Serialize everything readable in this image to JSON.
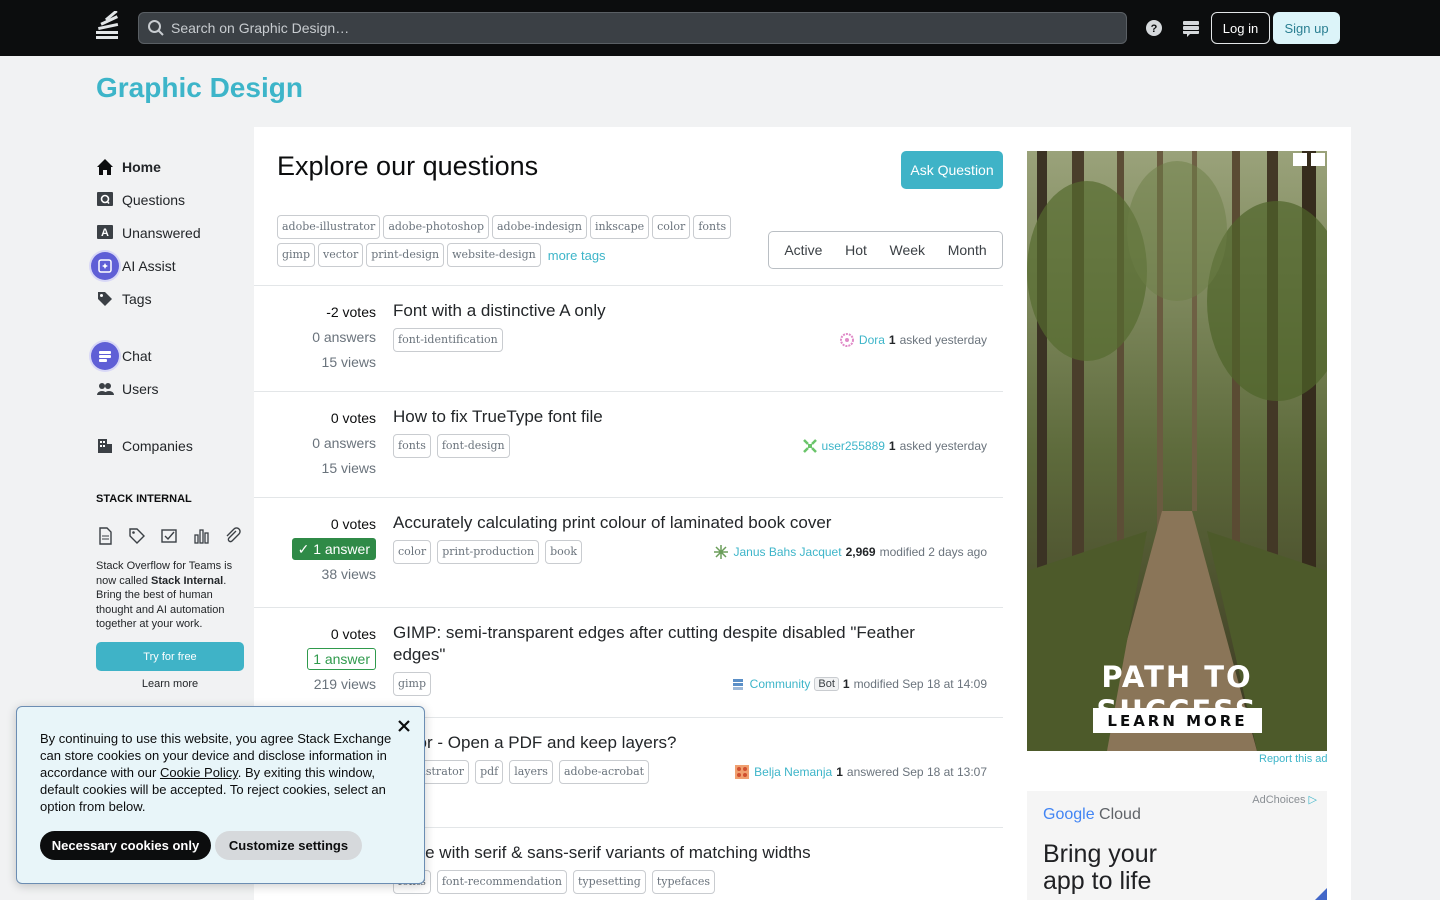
{
  "header": {
    "search_placeholder": "Search on Graphic Design…",
    "login_label": "Log in",
    "signup_label": "Sign up"
  },
  "site": {
    "title": "Graphic Design"
  },
  "nav": {
    "items": [
      {
        "label": "Home",
        "icon": "home-icon"
      },
      {
        "label": "Questions",
        "icon": "questions-icon"
      },
      {
        "label": "Unanswered",
        "icon": "unanswered-icon"
      },
      {
        "label": "AI Assist",
        "icon": "ai-assist-icon"
      },
      {
        "label": "Tags",
        "icon": "tag-icon"
      },
      {
        "label": "Chat",
        "icon": "chat-icon"
      },
      {
        "label": "Users",
        "icon": "users-icon"
      },
      {
        "label": "Companies",
        "icon": "companies-icon"
      }
    ],
    "stack_internal_heading": "STACK INTERNAL",
    "stack_internal_text_1": "Stack Overflow for Teams is now called ",
    "stack_internal_text_bold": "Stack Internal",
    "stack_internal_text_2": ". Bring the best of human thought and AI automation together at your work.",
    "try_label": "Try for free",
    "learn_more_label": "Learn more"
  },
  "main": {
    "heading": "Explore our questions",
    "ask_label": "Ask Question",
    "tags": [
      "adobe-illustrator",
      "adobe-photoshop",
      "adobe-indesign",
      "inkscape",
      "color",
      "fonts",
      "gimp",
      "vector",
      "print-design",
      "website-design"
    ],
    "more_tags_label": "more tags",
    "filters": [
      "Active",
      "Hot",
      "Week",
      "Month"
    ]
  },
  "questions": [
    {
      "votes": "-2 votes",
      "answers": "0 answers",
      "views": "15 views",
      "title": "Font with a distinctive A only",
      "tags": [
        "font-identification"
      ],
      "user": "Dora",
      "rep": "1",
      "action": "asked yesterday"
    },
    {
      "votes": "0 votes",
      "answers": "0 answers",
      "views": "15 views",
      "title": "How to fix TrueType font file",
      "tags": [
        "fonts",
        "font-design"
      ],
      "user": "user255889",
      "rep": "1",
      "action": "asked yesterday"
    },
    {
      "votes": "0 votes",
      "answers": "1 answer",
      "views": "38 views",
      "title": "Accurately calculating print colour of laminated book cover",
      "tags": [
        "color",
        "print-production",
        "book"
      ],
      "user": "Janus Bahs Jacquet",
      "rep": "2,969",
      "action": "modified 2 days ago"
    },
    {
      "votes": "0 votes",
      "answers": "1 answer",
      "views": "219 views",
      "title": "GIMP: semi-transparent edges after cutting despite disabled \"Feather edges\"",
      "tags": [
        "gimp"
      ],
      "user": "Community",
      "bot": "Bot",
      "rep": "1",
      "action": "modified Sep 18 at 14:09"
    },
    {
      "title": "trator - Open a PDF and keep layers?",
      "tags": [
        "e-illustrator",
        "pdf",
        "layers",
        "adobe-acrobat"
      ],
      "user": "Belja Nemanja",
      "rep": "1",
      "action": "answered Sep 18 at 13:07"
    },
    {
      "title": "eface with serif & sans-serif variants of matching widths",
      "tags": [
        "fonts",
        "font-recommendation",
        "typesetting",
        "typefaces"
      ]
    }
  ],
  "ads": {
    "tagline": "PATH TO SUCCESS",
    "cta": "LEARN MORE",
    "report_label": "Report this ad",
    "adchoices_label": "AdChoices",
    "gc_brand_g": "Google",
    "gc_brand_c": " Cloud",
    "headline_1": "Bring your",
    "headline_2": "app to life"
  },
  "cookie": {
    "text_1": "By continuing to use this website, you agree Stack Exchange can store cookies on your device and disclose information in accordance with our ",
    "link": "Cookie Policy",
    "text_2": ". By exiting this window, default cookies will be accepted. To reject cookies, select an option from below.",
    "necessary_label": "Necessary cookies only",
    "customize_label": "Customize settings"
  },
  "colors": {
    "accent": "#3db5c9",
    "accepted_green": "#2f8a47",
    "topbar": "#0c0d0e"
  }
}
